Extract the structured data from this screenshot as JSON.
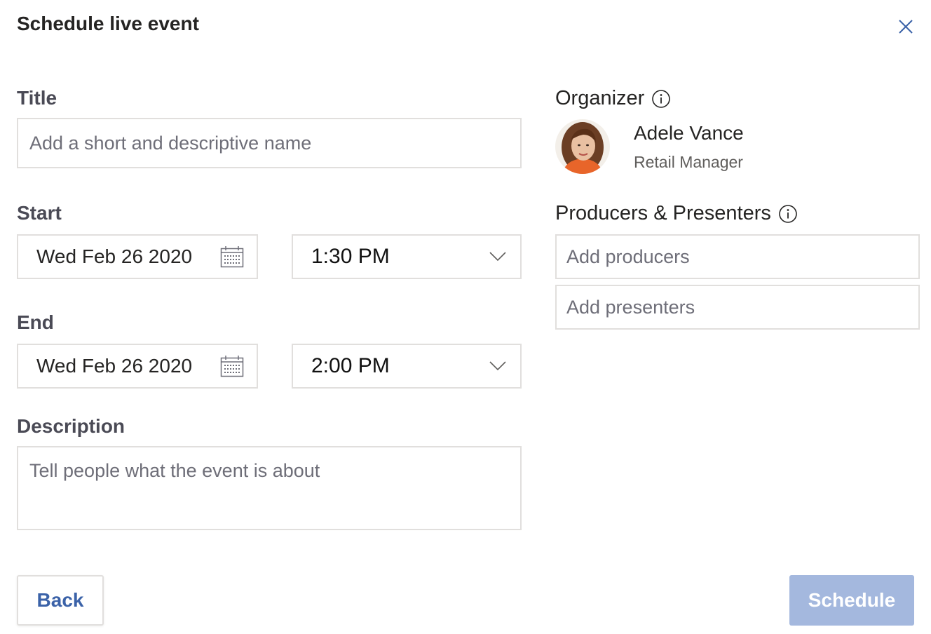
{
  "dialog": {
    "title": "Schedule live event"
  },
  "form": {
    "title": {
      "label": "Title",
      "placeholder": "Add a short and descriptive name"
    },
    "start": {
      "label": "Start",
      "date": "Wed Feb 26 2020",
      "time": "1:30 PM"
    },
    "end": {
      "label": "End",
      "date": "Wed Feb 26 2020",
      "time": "2:00 PM"
    },
    "description": {
      "label": "Description",
      "placeholder": "Tell people what the event is about"
    }
  },
  "organizer": {
    "label": "Organizer",
    "name": "Adele Vance",
    "role": "Retail Manager"
  },
  "producers_presenters": {
    "label": "Producers & Presenters",
    "producers_placeholder": "Add producers",
    "presenters_placeholder": "Add presenters"
  },
  "footer": {
    "back_label": "Back",
    "schedule_label": "Schedule"
  },
  "icons": {
    "close": "close-icon",
    "calendar": "calendar-icon",
    "chevron": "chevron-down-icon",
    "info": "info-icon"
  },
  "colors": {
    "accent": "#3b62a8",
    "schedule_disabled_bg": "#a4b8de",
    "border": "#e1dfdd"
  }
}
